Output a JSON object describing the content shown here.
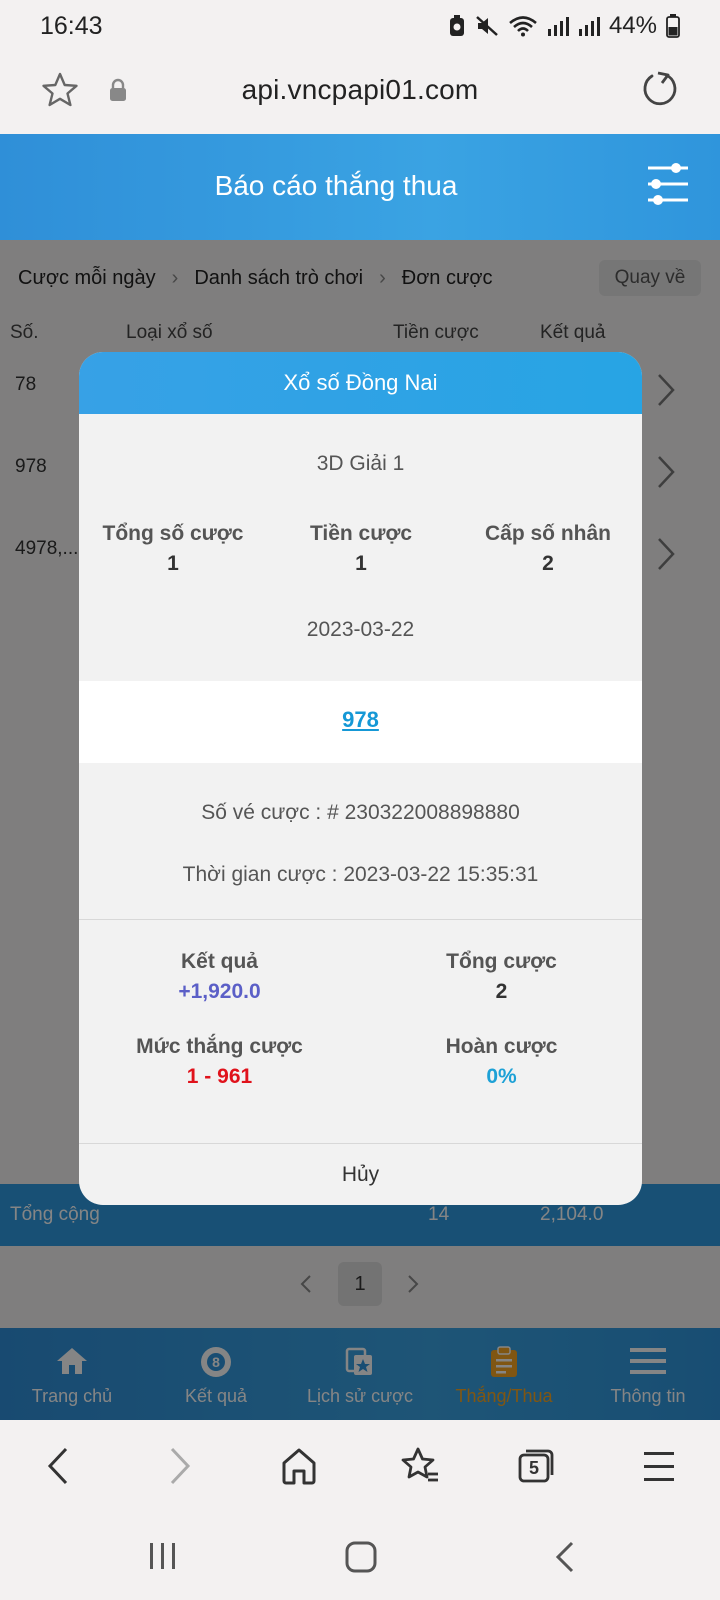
{
  "status": {
    "time": "16:43",
    "battery": "44%"
  },
  "browser": {
    "url": "api.vncpapi01.com"
  },
  "header": {
    "title": "Báo cáo thắng thua"
  },
  "breadcrumb": {
    "items": [
      "Cược mỗi ngày",
      "Danh sách trò chơi",
      "Đơn cược"
    ],
    "back_label": "Quay về"
  },
  "table": {
    "columns": [
      "Số.",
      "Loại xổ số",
      "Tiền cược",
      "Kết quả"
    ],
    "rows": [
      "78",
      "978",
      "4978,..."
    ]
  },
  "total": {
    "label": "Tổng cộng",
    "bet": "14",
    "result": "2,104.0"
  },
  "pager": {
    "current": "1"
  },
  "nav": [
    "Trang chủ",
    "Kết quả",
    "Lịch sử cược",
    "Thắng/Thua",
    "Thông tin"
  ],
  "modal": {
    "title": "Xổ số Đồng Nai",
    "subtitle": "3D Giải 1",
    "stats": [
      {
        "label": "Tổng số cược",
        "value": "1"
      },
      {
        "label": "Tiền cược",
        "value": "1"
      },
      {
        "label": "Cấp số nhân",
        "value": "2"
      }
    ],
    "date": "2023-03-22",
    "number": "978",
    "ticket": "Số vé cược : # 230322008898880",
    "time": "Thời gian cược : 2023-03-22 15:35:31",
    "result": {
      "label": "Kết quả",
      "value": "+1,920.0"
    },
    "total_bet": {
      "label": "Tổng cược",
      "value": "2"
    },
    "win_level": {
      "label": "Mức thắng cược",
      "value": "1 - 961"
    },
    "refund": {
      "label": "Hoàn cược",
      "value": "0%"
    },
    "cancel_label": "Hủy",
    "colors": {
      "result": "#5b5fc7",
      "win_level": "#e0121b",
      "refund": "#1da1d6"
    }
  },
  "browser_nav": {
    "tabs_count": "5"
  }
}
